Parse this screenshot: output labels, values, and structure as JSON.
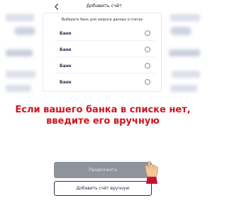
{
  "header": {
    "title": "Добавить счёт",
    "back_icon": "chevron-left-icon"
  },
  "card": {
    "subtitle": "Выберите банк для запроса данных о счетах",
    "banks": [
      {
        "label": "Банк",
        "selected": false
      },
      {
        "label": "Банк",
        "selected": false
      },
      {
        "label": "Банк",
        "selected": false
      },
      {
        "label": "Банк",
        "selected": false
      }
    ]
  },
  "caption": {
    "line1": "Если вашего банка в списке нет,",
    "line2": "введите его вручную",
    "color": "#d0141f"
  },
  "buttons": {
    "continue_label": "Продолжить",
    "add_manual_label": "Добавить счёт вручную"
  },
  "pointer": {
    "icon": "hand-pointer-icon"
  }
}
